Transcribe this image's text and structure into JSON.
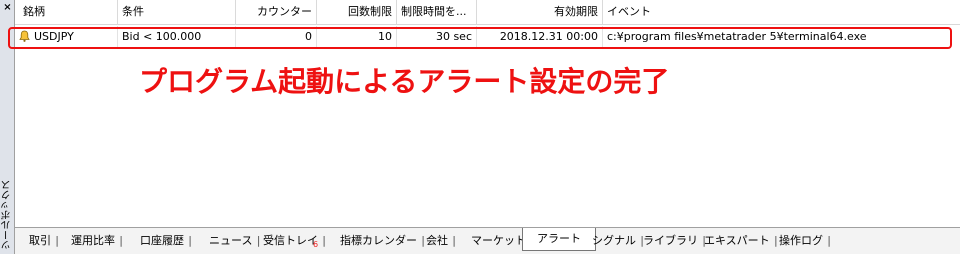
{
  "toolbox": {
    "close_label": "×",
    "title": "ツールボックス"
  },
  "columns": [
    "銘柄",
    "条件",
    "カウンター",
    "回数制限",
    "制限時間を...",
    "有効期限",
    "イベント"
  ],
  "alert_row": {
    "symbol": "USDJPY",
    "condition": "Bid < 100.000",
    "counter": "0",
    "limit": "10",
    "timeout": "30 sec",
    "expiration": "2018.12.31 00:00",
    "event": "c:¥program files¥metatrader 5¥terminal64.exe"
  },
  "annotation": "プログラム起動によるアラート設定の完了",
  "tabs": [
    "取引",
    "運用比率",
    "口座履歴",
    "ニュース",
    "受信トレイ",
    "指標カレンダー",
    "会社",
    "マーケット",
    "アラート",
    "シグナル",
    "ライブラリ",
    "エキスパート",
    "操作ログ"
  ],
  "inbox_badge": "6",
  "active_tab": "アラート",
  "colors": {
    "highlight": "#ee1111",
    "annotation": "#ee1111",
    "badge": "#ee2222"
  },
  "icons": {
    "alert_row": "bell-icon"
  }
}
